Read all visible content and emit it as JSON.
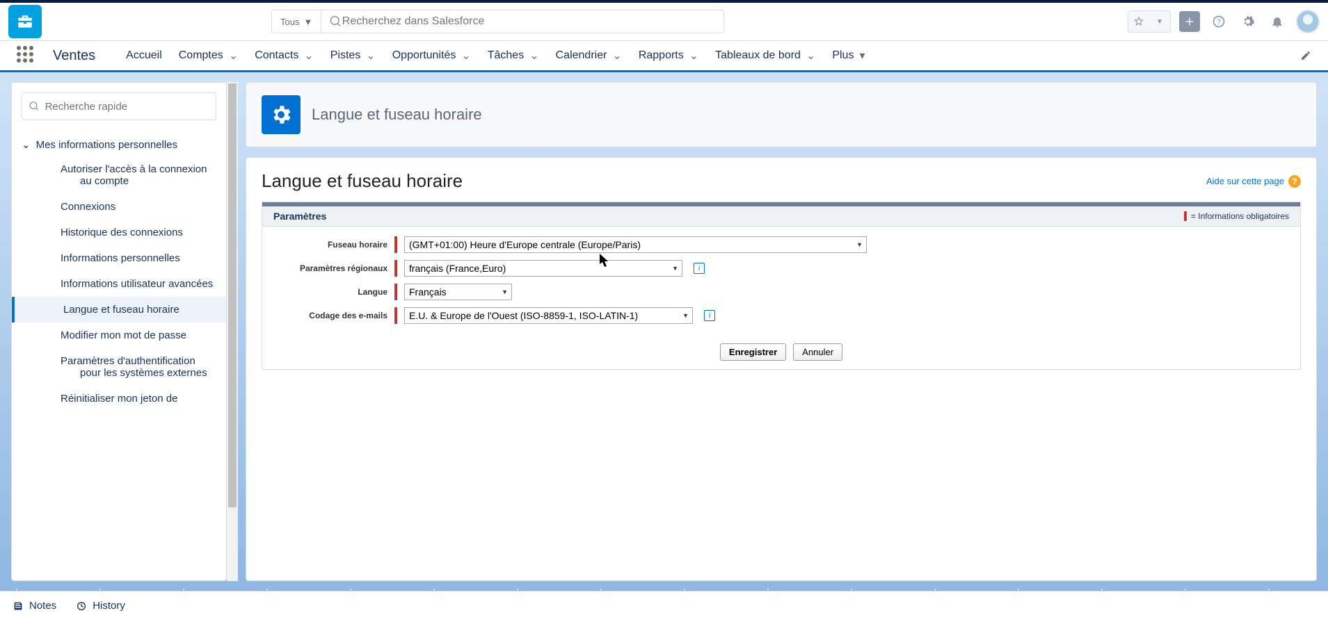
{
  "header": {
    "scope_label": "Tous",
    "search_placeholder": "Recherchez dans Salesforce"
  },
  "nav": {
    "app_name": "Ventes",
    "items": [
      "Accueil",
      "Comptes",
      "Contacts",
      "Pistes",
      "Opportunités",
      "Tâches",
      "Calendrier",
      "Rapports",
      "Tableaux de bord"
    ],
    "more_label": "Plus"
  },
  "sidebar": {
    "quick_find_placeholder": "Recherche rapide",
    "section_title": "Mes informations personnelles",
    "items": [
      "Autoriser l'accès à la connexion au compte",
      "Connexions",
      "Historique des connexions",
      "Informations personnelles",
      "Informations utilisateur avancées",
      "Langue et fuseau horaire",
      "Modifier mon mot de passe",
      "Paramètres d'authentification pour les systèmes externes",
      "Réinitialiser mon jeton de"
    ],
    "active_index": 5
  },
  "page": {
    "header_title": "Langue et fuseau horaire",
    "content_title": "Langue et fuseau horaire",
    "help_link": "Aide sur cette page",
    "section_title": "Paramètres",
    "required_legend": "= Informations obligatoires",
    "fields": {
      "timezone": {
        "label": "Fuseau horaire",
        "value": "(GMT+01:00) Heure d'Europe centrale (Europe/Paris)"
      },
      "locale": {
        "label": "Paramètres régionaux",
        "value": "français (France,Euro)"
      },
      "language": {
        "label": "Langue",
        "value": "Français"
      },
      "encoding": {
        "label": "Codage des e-mails",
        "value": "E.U. & Europe de l'Ouest (ISO-8859-1, ISO-LATIN-1)"
      }
    },
    "buttons": {
      "save": "Enregistrer",
      "cancel": "Annuler"
    }
  },
  "footer": {
    "notes": "Notes",
    "history": "History"
  }
}
